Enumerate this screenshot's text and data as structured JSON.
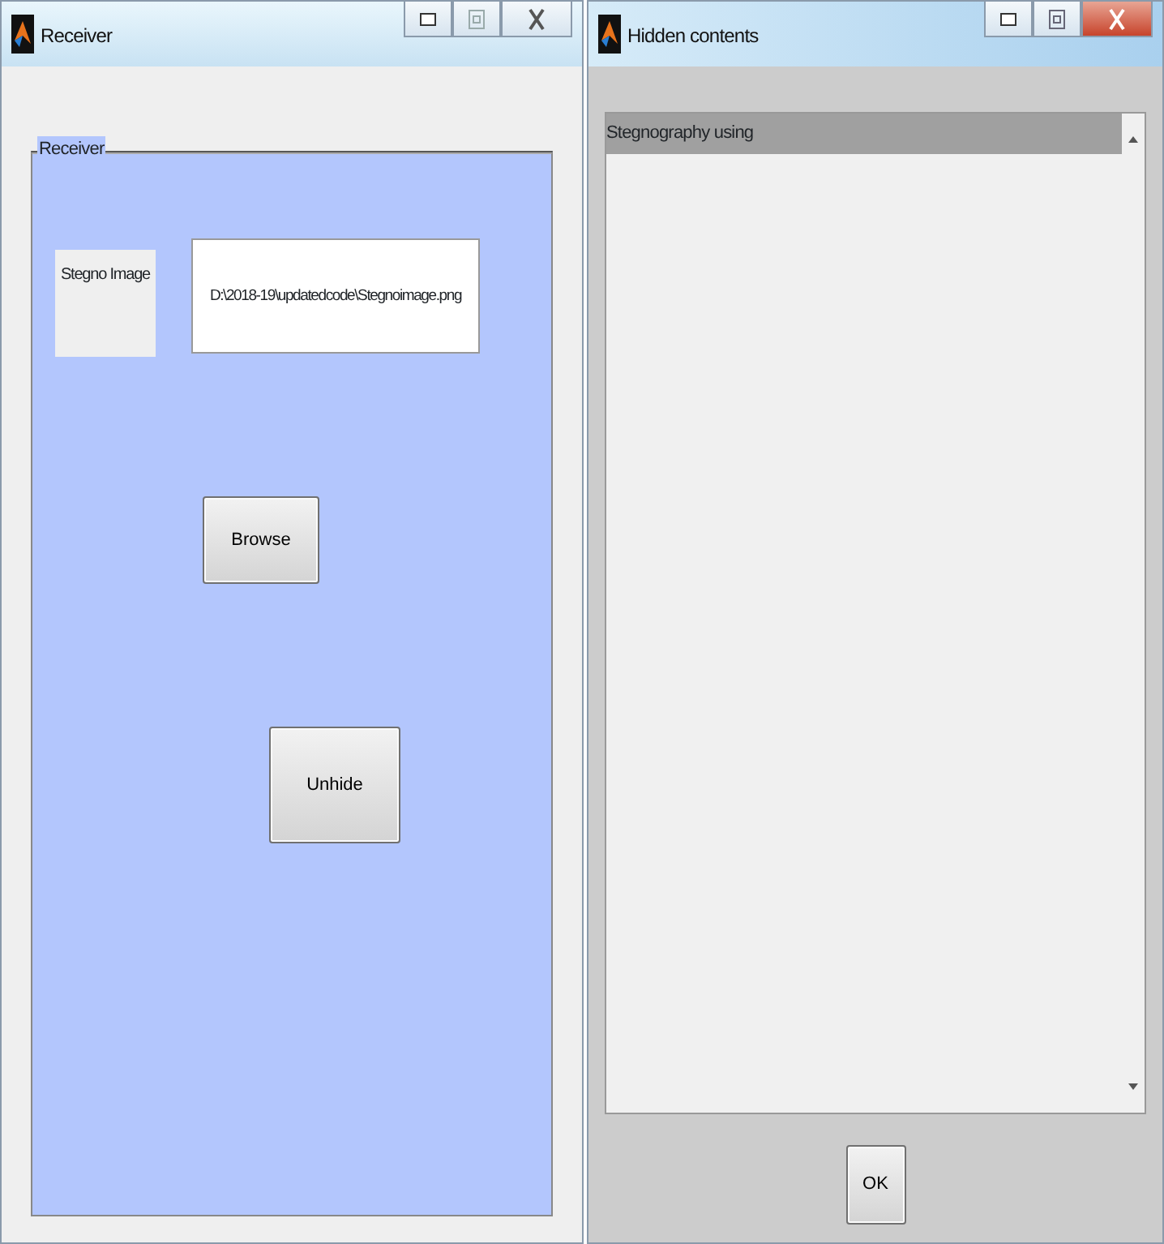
{
  "receiver_window": {
    "title": "Receiver",
    "panel_title": "Receiver",
    "image_label": "Stegno Image",
    "path_field": {
      "value": "D:\\2018-19\\updatedcode\\Stegnoimage.png"
    },
    "browse_button": "Browse",
    "unhide_button": "Unhide"
  },
  "hidden_window": {
    "title": "Hidden contents",
    "items": [
      {
        "text": "Stegnography using",
        "selected": true
      }
    ],
    "ok_button": "OK"
  }
}
